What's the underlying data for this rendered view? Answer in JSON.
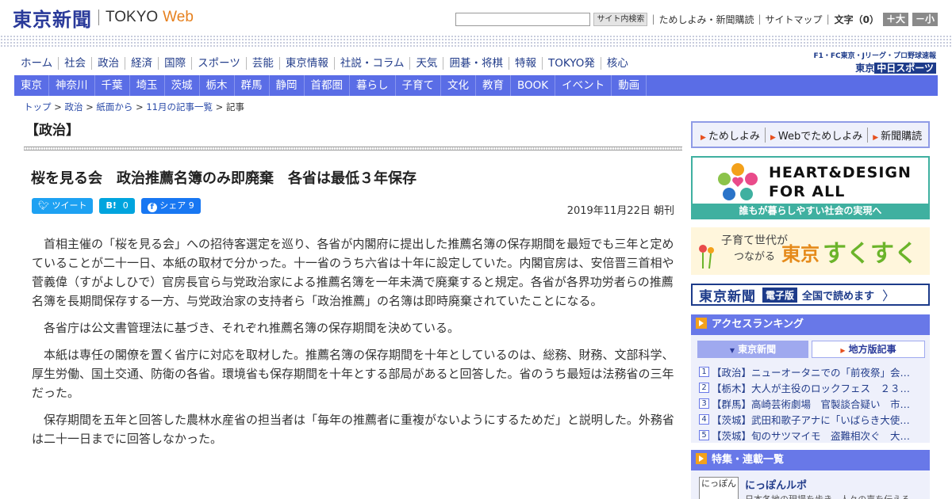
{
  "header": {
    "logo_jp": "東京新聞",
    "logo_en1": "TOKYO",
    "logo_en2": "Web",
    "search_button": "サイト内検索",
    "links": [
      "ためしよみ・新聞購読",
      "サイトマップ"
    ],
    "font_size_label": "文字（0）",
    "font_plus": "＋大",
    "font_minus": "－小"
  },
  "nav_primary": [
    "ホーム",
    "社会",
    "政治",
    "経済",
    "国際",
    "スポーツ",
    "芸能",
    "東京情報",
    "社説・コラム",
    "天気",
    "囲碁・将棋",
    "特報",
    "TOKYO発",
    "核心"
  ],
  "sports_promo": {
    "line1": "F1・FC東京・Jリーグ・プロ野球速報",
    "line2_prefix": "東京",
    "line2_logo": "中日スポーツ"
  },
  "nav_regional": [
    "東京",
    "神奈川",
    "千葉",
    "埼玉",
    "茨城",
    "栃木",
    "群馬",
    "静岡",
    "首都圏",
    "暮らし",
    "子育て",
    "文化",
    "教育",
    "BOOK",
    "イベント",
    "動画"
  ],
  "breadcrumb": [
    "トップ",
    "政治",
    "紙面から",
    "11月の記事一覧",
    "記事"
  ],
  "breadcrumb_sep": " > ",
  "article": {
    "section": "【政治】",
    "headline": "桜を見る会　政治推薦名簿のみ即廃棄　各省は最低３年保存",
    "social": {
      "tweet": "ツイート",
      "hatena": "B!",
      "hatena_count": "0",
      "fb_share": "シェア",
      "fb_count": "9"
    },
    "date": "2019年11月22日 朝刊",
    "paragraphs": [
      "首相主催の「桜を見る会」への招待客選定を巡り、各省が内閣府に提出した推薦名簿の保存期間を最短でも三年と定めていることが二十一日、本紙の取材で分かった。十一省のうち六省は十年に設定していた。内閣官房は、安倍晋三首相や菅義偉（すがよしひで）官房長官ら与党政治家による推薦名簿を一年未満で廃棄すると規定。各省が各界功労者らの推薦名簿を長期間保存する一方、与党政治家の支持者ら「政治推薦」の名簿は即時廃棄されていたことになる。",
      "各省庁は公文書管理法に基づき、それぞれ推薦名簿の保存期間を決めている。",
      "本紙は専任の閣僚を置く省庁に対応を取材した。推薦名簿の保存期間を十年としているのは、総務、財務、文部科学、厚生労働、国土交通、防衛の各省。環境省も保存期間を十年とする部局があると回答した。省のうち最短は法務省の三年だった。",
      "保存期間を五年と回答した農林水産省の担当者は「毎年の推薦者に重複がないようにするためだ」と説明した。外務省は二十一日までに回答しなかった。"
    ]
  },
  "sidebar": {
    "trial_links": [
      "ためしよみ",
      "Webでためしよみ",
      "新聞購読"
    ],
    "heart_banner": {
      "line1": "HEART&DESIGN",
      "line2": "FOR ALL",
      "caption": "誰もが暮らしやすい社会の実現へ"
    },
    "sukusuku_banner": {
      "line1": "子育て世代が",
      "line2": "つながる",
      "brand1": "東京",
      "brand2": "すくすく"
    },
    "digital_banner": {
      "brand": "東京新聞",
      "tag": "電子版",
      "text": "全国で読めます",
      "arrow": "〉"
    },
    "ranking": {
      "title": "アクセスランキング",
      "tab_tokyo": "東京新聞",
      "tab_local": "地方版記事",
      "items": [
        {
          "n": "1",
          "text": "【政治】ニューオータニでの「前夜祭」会…"
        },
        {
          "n": "2",
          "text": "【栃木】大人が主役のロックフェス　２３…"
        },
        {
          "n": "3",
          "text": "【群馬】高崎芸術劇場　官製談合疑い　市…"
        },
        {
          "n": "4",
          "text": "【茨城】武田和歌子アナに「いばらき大使…"
        },
        {
          "n": "5",
          "text": "【茨城】旬のサツマイモ　盗難相次ぐ　大…"
        }
      ]
    },
    "features": {
      "title": "特集・連載一覧",
      "thumb": "にっぽん",
      "item_title": "にっぽんルポ",
      "item_sub": "日本各地の現場を歩き、人々の声を伝える"
    }
  },
  "colors": {
    "nav_blue": "#5a6de6",
    "brand_navy": "#2a3a9a",
    "accent_orange": "#e6801e",
    "teal": "#3fb0a0"
  }
}
